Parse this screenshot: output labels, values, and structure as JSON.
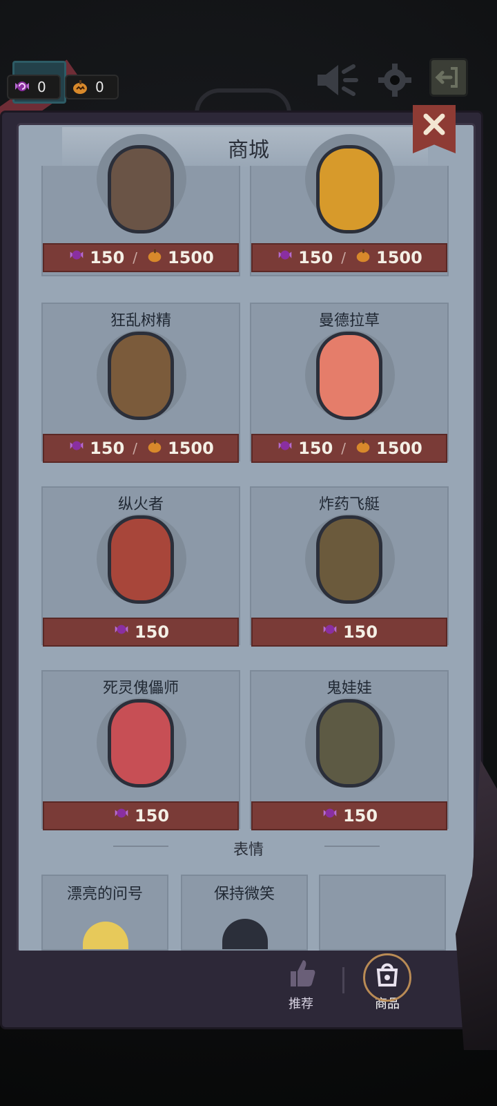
{
  "top_bar": {
    "candy_count": "0",
    "pumpkin_count": "0"
  },
  "shop": {
    "title": "商城",
    "characters": [
      {
        "name": "",
        "candy_price": "150",
        "pumpkin_price": "1500"
      },
      {
        "name": "",
        "candy_price": "150",
        "pumpkin_price": "1500"
      },
      {
        "name": "狂乱树精",
        "candy_price": "150",
        "pumpkin_price": "1500"
      },
      {
        "name": "曼德拉草",
        "candy_price": "150",
        "pumpkin_price": "1500"
      },
      {
        "name": "纵火者",
        "candy_price": "150"
      },
      {
        "name": "炸药飞艇",
        "candy_price": "150"
      },
      {
        "name": "死灵傀儡师",
        "candy_price": "150"
      },
      {
        "name": "鬼娃娃",
        "candy_price": "150"
      }
    ],
    "price_separator": "/",
    "emote_section_label": "表情",
    "emotes": [
      {
        "name": "漂亮的问号"
      },
      {
        "name": "保持微笑"
      },
      {
        "name": ""
      }
    ]
  },
  "bottom_nav": {
    "items": [
      {
        "label": "推荐"
      },
      {
        "label": "商品"
      }
    ]
  },
  "colors": {
    "price_bar": "#7a3b37",
    "panel_inner": "#98a6b5",
    "candy_purple": "#8a2fa0",
    "pumpkin_orange": "#d8892b"
  },
  "icons": {
    "candy": "candy-icon",
    "pumpkin": "pumpkin-icon",
    "mute": "speaker-mute-icon",
    "settings": "gear-icon",
    "exit": "exit-icon",
    "close": "close-icon",
    "recommend": "thumbs-up-icon",
    "goods": "shop-bag-icon"
  }
}
